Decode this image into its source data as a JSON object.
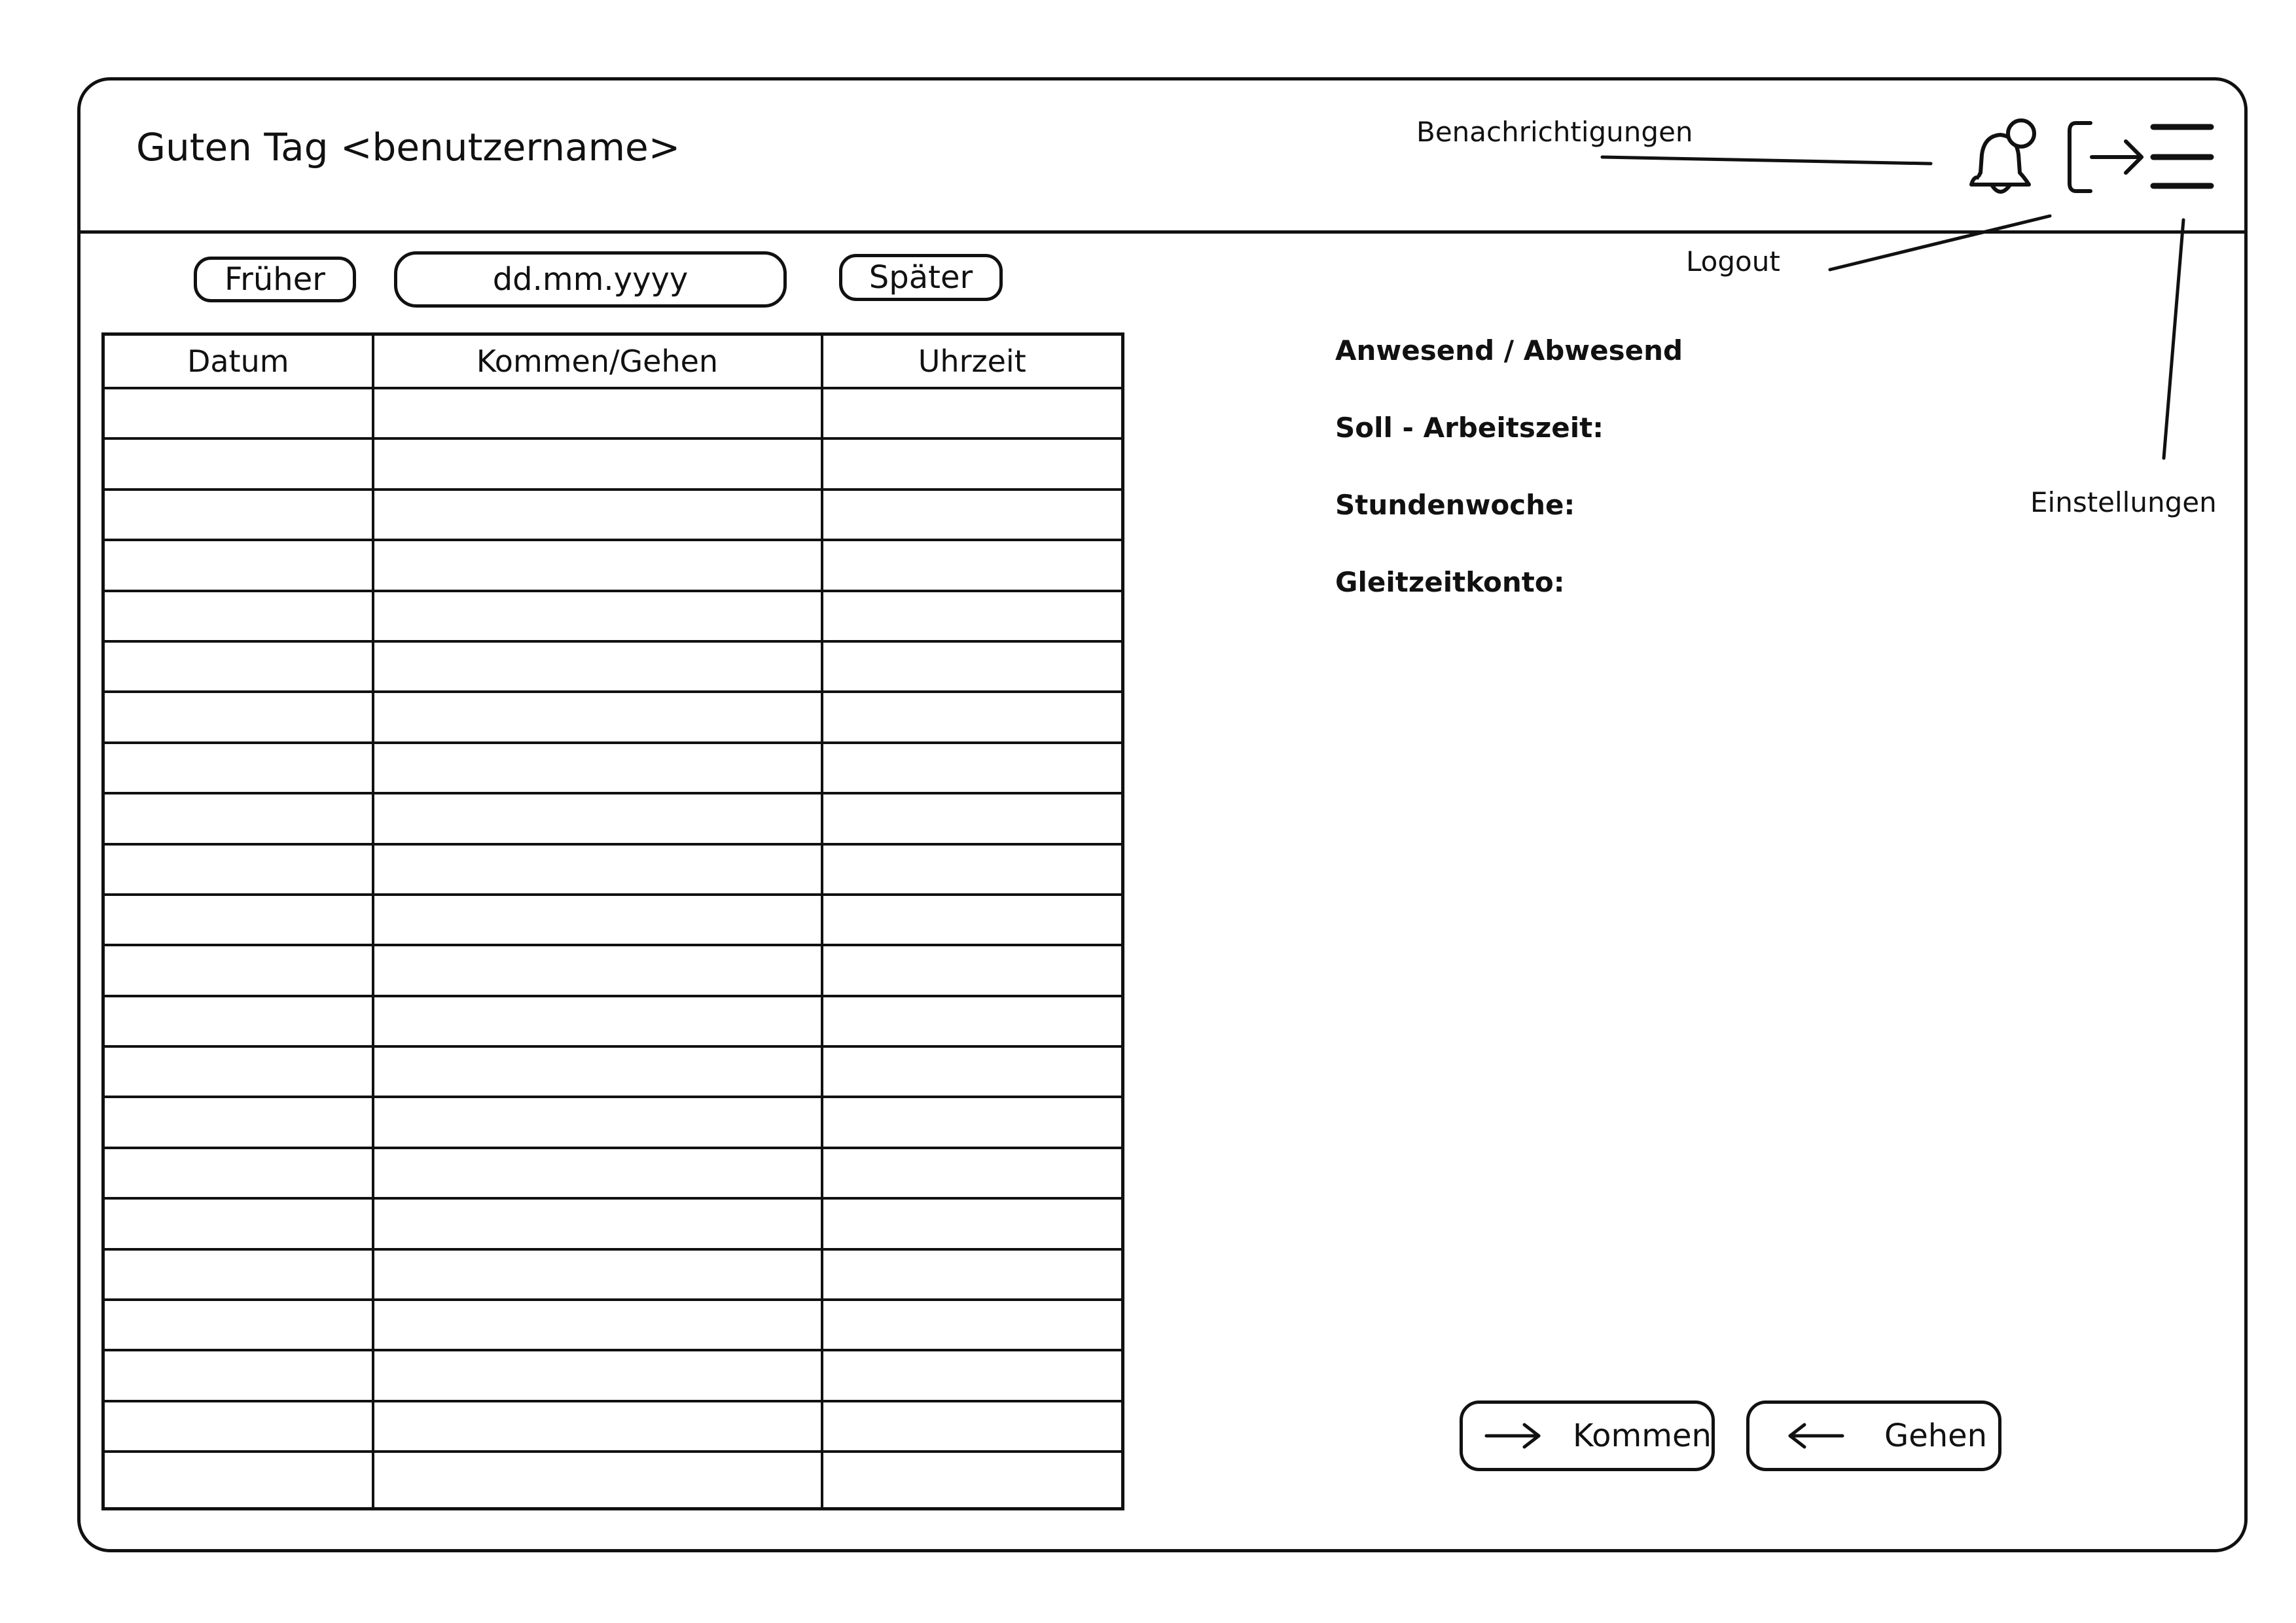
{
  "header": {
    "greeting": "Guten Tag <benutzername>"
  },
  "icons": {
    "notification": "bell-icon",
    "logout": "logout-icon",
    "settings": "menu-icon"
  },
  "annotations": {
    "notifications": "Benachrichtigungen",
    "logout": "Logout",
    "settings": "Einstellungen"
  },
  "date_nav": {
    "earlier_label": "Früher",
    "date_placeholder": "dd.mm.yyyy",
    "later_label": "Später"
  },
  "table": {
    "columns": [
      "Datum",
      "Kommen/Gehen",
      "Uhrzeit"
    ]
  },
  "info": {
    "presence": "Anwesend / Abwesend",
    "target_hours": "Soll - Arbeitszeit:",
    "weekly_hours": "Stundenwoche:",
    "flextime": "Gleitzeitkonto:"
  },
  "actions": {
    "clock_in_label": "Kommen",
    "clock_out_label": "Gehen"
  }
}
